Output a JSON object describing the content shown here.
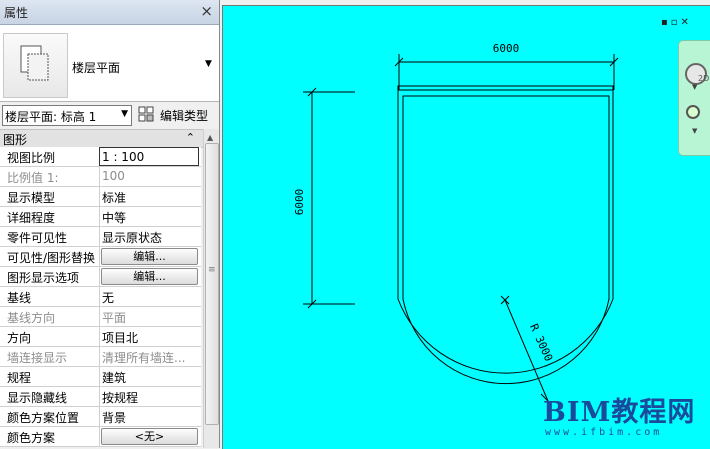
{
  "panel": {
    "title": "属性",
    "close": "×",
    "type_name": "楼层平面",
    "instance_selector": "楼层平面: 标高 1",
    "edit_type": "编辑类型",
    "group": "图形",
    "collapse": "»",
    "rows": [
      {
        "key": "视图比例",
        "value": "1 : 100"
      },
      {
        "key": "比例值 1:",
        "value": "100"
      },
      {
        "key": "显示模型",
        "value": "标准"
      },
      {
        "key": "详细程度",
        "value": "中等"
      },
      {
        "key": "零件可见性",
        "value": "显示原状态"
      },
      {
        "key": "可见性/图形替换",
        "value": "编辑..."
      },
      {
        "key": "图形显示选项",
        "value": "编辑..."
      },
      {
        "key": "基线",
        "value": "无"
      },
      {
        "key": "基线方向",
        "value": "平面"
      },
      {
        "key": "方向",
        "value": "项目北"
      },
      {
        "key": "墙连接显示",
        "value": "清理所有墙连..."
      },
      {
        "key": "规程",
        "value": "建筑"
      },
      {
        "key": "显示隐藏线",
        "value": "按规程"
      },
      {
        "key": "颜色方案位置",
        "value": "背景"
      },
      {
        "key": "颜色方案",
        "value": "<无>"
      }
    ]
  },
  "drawing": {
    "dim_width": "6000",
    "dim_height": "6000",
    "dim_radius": "R 3000",
    "background": "#00ffff"
  },
  "navbar": {
    "label_2d": "2D"
  },
  "watermark": {
    "title": "BIM教程网",
    "url": "www.ifbim.com"
  }
}
